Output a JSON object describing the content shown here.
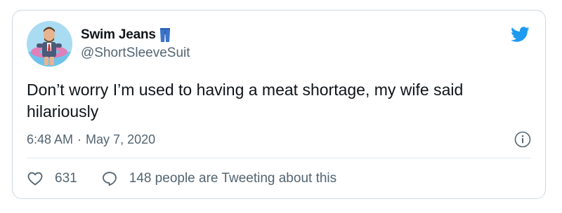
{
  "tweet": {
    "display_name": "Swim Jeans",
    "handle": "@ShortSleeveSuit",
    "text": "Don’t worry I’m used to having a meat shortage, my wife said hilariously",
    "time": "6:48 AM",
    "separator": "·",
    "date": "May 7, 2020",
    "like_count": "631",
    "conversation_text": "148 people are Tweeting about this"
  },
  "icons": {
    "avatar": "profile-avatar",
    "verified_emoji": "jeans-emoji",
    "brand": "twitter-bird-icon",
    "info": "info-icon",
    "like": "heart-icon",
    "reply": "speech-bubble-icon"
  },
  "colors": {
    "brand_blue": "#1d9bf0",
    "text_primary": "#0f1419",
    "text_secondary": "#536471",
    "border": "#cfd9de"
  }
}
